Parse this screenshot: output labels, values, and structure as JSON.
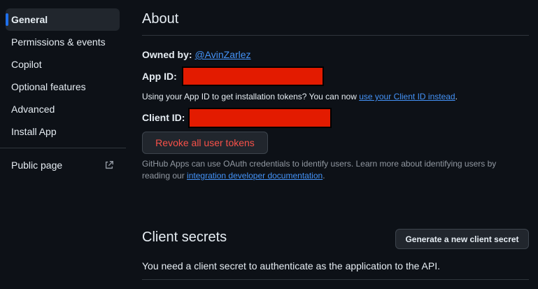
{
  "sidebar": {
    "items": [
      {
        "label": "General",
        "active": true
      },
      {
        "label": "Permissions & events"
      },
      {
        "label": "Copilot"
      },
      {
        "label": "Optional features"
      },
      {
        "label": "Advanced"
      },
      {
        "label": "Install App"
      }
    ],
    "public_page": {
      "label": "Public page",
      "icon": "external-link-icon"
    }
  },
  "about": {
    "title": "About",
    "owned_by_label": "Owned by:",
    "owner": "@AvinZarlez",
    "app_id_label": "App ID:",
    "install_tokens_text": "Using your App ID to get installation tokens? You can now ",
    "install_tokens_link": "use your Client ID instead",
    "install_tokens_suffix": ".",
    "client_id_label": "Client ID:",
    "revoke_button": "Revoke all user tokens",
    "oauth_text_1": "GitHub Apps can use OAuth credentials to identify users. Learn more about identifying users by",
    "oauth_text_2": "reading our ",
    "oauth_link": "integration developer documentation",
    "oauth_suffix": "."
  },
  "client_secrets": {
    "title": "Client secrets",
    "generate_button": "Generate a new client secret",
    "description": "You need a client secret to authenticate as the application to the API."
  },
  "colors": {
    "background": "#0d1117",
    "accent": "#1f6feb",
    "link": "#4493f8",
    "danger": "#f85149",
    "redaction": "#e31b00"
  }
}
